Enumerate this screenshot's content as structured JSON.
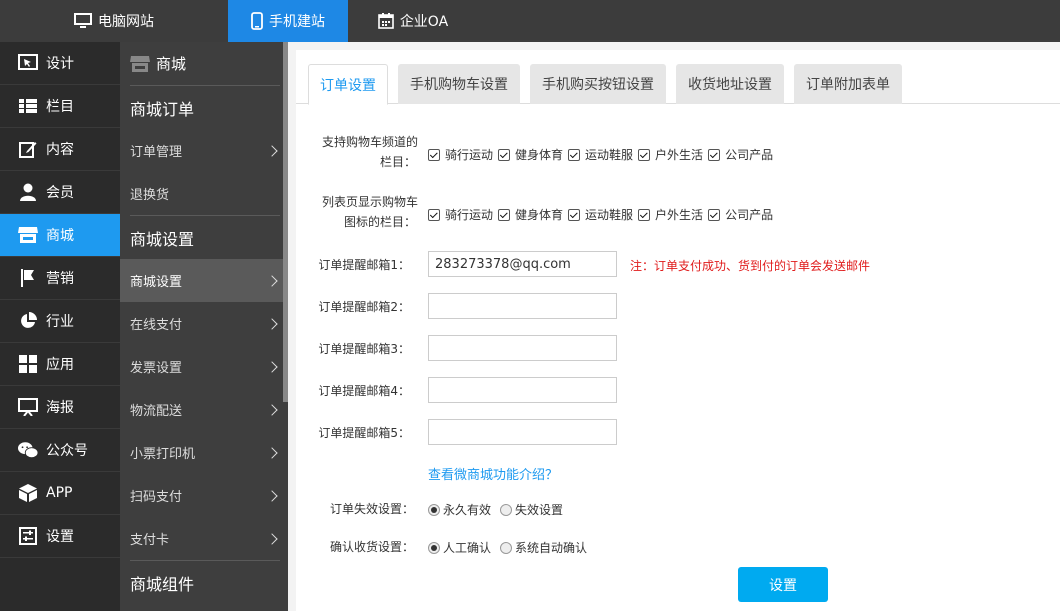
{
  "topbar": {
    "tabs": [
      {
        "label": "电脑网站",
        "icon": "monitor-icon"
      },
      {
        "label": "手机建站",
        "icon": "phone-icon"
      },
      {
        "label": "企业OA",
        "icon": "calendar-icon"
      }
    ]
  },
  "nav1": {
    "items": [
      {
        "label": "设计",
        "icon": "design-icon"
      },
      {
        "label": "栏目",
        "icon": "list-icon"
      },
      {
        "label": "内容",
        "icon": "edit-icon"
      },
      {
        "label": "会员",
        "icon": "user-icon"
      },
      {
        "label": "商城",
        "icon": "store-icon"
      },
      {
        "label": "营销",
        "icon": "flag-icon"
      },
      {
        "label": "行业",
        "icon": "pie-icon"
      },
      {
        "label": "应用",
        "icon": "grid-icon"
      },
      {
        "label": "海报",
        "icon": "poster-icon"
      },
      {
        "label": "公众号",
        "icon": "wechat-icon"
      },
      {
        "label": "APP",
        "icon": "box-icon"
      },
      {
        "label": "设置",
        "icon": "sliders-icon"
      }
    ]
  },
  "nav2": {
    "header": "商城",
    "sections": [
      {
        "title": "商城订单",
        "items": [
          "订单管理",
          "退换货"
        ]
      },
      {
        "title": "商城设置",
        "items": [
          "商城设置",
          "在线支付",
          "发票设置",
          "物流配送",
          "小票打印机",
          "扫码支付",
          "支付卡"
        ]
      },
      {
        "title": "商城组件",
        "items": []
      }
    ]
  },
  "tabs": [
    "订单设置",
    "手机购物车设置",
    "手机购买按钮设置",
    "收货地址设置",
    "订单附加表单"
  ],
  "form": {
    "cart_channel_label": "支持购物车频道的栏目：",
    "cart_channel_label_l1": "支持购物车频道的",
    "cart_channel_label_l2": "栏目：",
    "list_cart_label_l1": "列表页显示购物车",
    "list_cart_label_l2": "图标的栏目：",
    "categories": [
      "骑行运动",
      "健身体育",
      "运动鞋服",
      "户外生活",
      "公司产品"
    ],
    "email_labels": [
      "订单提醒邮箱1：",
      "订单提醒邮箱2：",
      "订单提醒邮箱3：",
      "订单提醒邮箱4：",
      "订单提醒邮箱5："
    ],
    "email_values": [
      "283273378@qq.com",
      "",
      "",
      "",
      ""
    ],
    "note": "注：订单支付成功、货到付的订单会发送邮件",
    "intro_link": "查看微商城功能介绍？",
    "expire_label": "订单失效设置：",
    "expire_options": [
      "永久有效",
      "失效设置"
    ],
    "expire_selected": "永久有效",
    "confirm_label": "确认收货设置：",
    "confirm_options": [
      "人工确认",
      "系统自动确认"
    ],
    "confirm_selected": "人工确认",
    "submit": "设置"
  }
}
